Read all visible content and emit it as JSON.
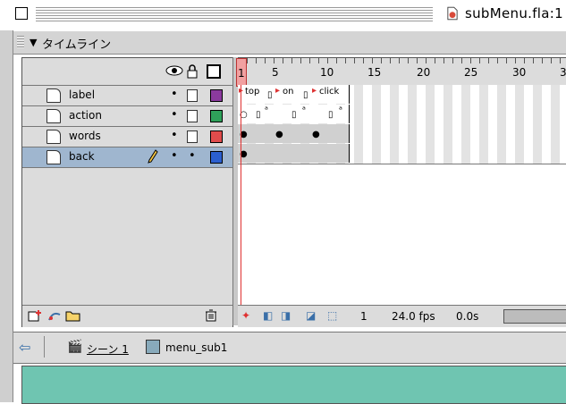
{
  "window": {
    "title": "subMenu.fla:1",
    "doc_icon": "fla-document-icon"
  },
  "panel": {
    "title": "タイムライン",
    "collapse_glyph": "▼"
  },
  "layer_header_icons": [
    "eye-icon",
    "lock-icon",
    "outline-icon"
  ],
  "layers": [
    {
      "name": "label",
      "swatch": "#8b3a9e",
      "selected": false
    },
    {
      "name": "action",
      "swatch": "#2fa15a",
      "selected": false
    },
    {
      "name": "words",
      "swatch": "#e04c4c",
      "selected": false
    },
    {
      "name": "back",
      "swatch": "#2b5fcf",
      "selected": true
    }
  ],
  "ruler": {
    "current_frame": "1",
    "ticks": [
      "5",
      "10",
      "15",
      "20",
      "25",
      "30",
      "3"
    ]
  },
  "frame_labels": [
    "top",
    "on",
    "click"
  ],
  "timeline_footer": {
    "frame": "1",
    "fps": "24.0 fps",
    "time": "0.0s"
  },
  "scene_bar": {
    "scene": "シーン 1",
    "symbol": "menu_sub1"
  },
  "colors": {
    "stage": "#6fc5b1",
    "playhead": "#e03030",
    "selected_layer": "#9fb6cf"
  }
}
